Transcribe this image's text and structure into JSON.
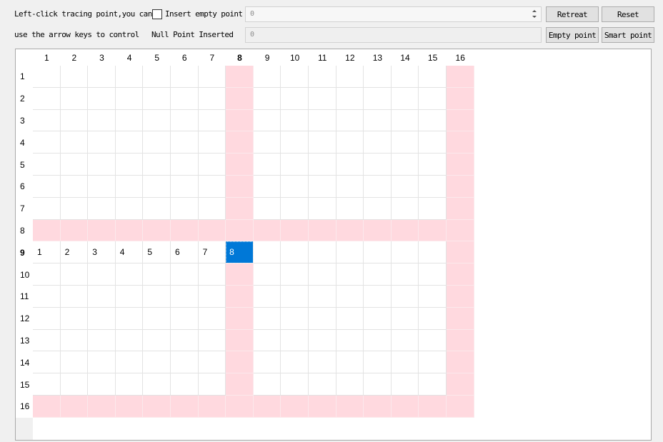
{
  "controls": {
    "hint_line1": "Left-click tracing point,you can",
    "insert_empty_checkbox": {
      "label": "Insert empty point",
      "checked": false
    },
    "spin_value": "0",
    "retreat_button": "Retreat",
    "reset_button": "Reset",
    "hint_line2": "use the arrow keys to control",
    "null_point_label": "Null Point Inserted",
    "null_point_value": "0",
    "empty_point_button": "Empty point",
    "smart_point_button": "Smart point"
  },
  "colors": {
    "highlight": "#ffd9df",
    "selection": "#0078d7"
  },
  "grid": {
    "column_headers": [
      "1",
      "2",
      "3",
      "4",
      "5",
      "6",
      "7",
      "8",
      "9",
      "10",
      "11",
      "12",
      "13",
      "14",
      "15",
      "16"
    ],
    "row_headers": [
      "1",
      "2",
      "3",
      "4",
      "5",
      "6",
      "7",
      "8",
      "9",
      "10",
      "11",
      "12",
      "13",
      "14",
      "15",
      "16"
    ],
    "highlighted_columns": [
      8,
      16
    ],
    "highlighted_rows": [
      8,
      16
    ],
    "current_cell": {
      "row": 9,
      "column": 8
    },
    "filled_cells": [
      {
        "row": 9,
        "column": 1,
        "value": "1"
      },
      {
        "row": 9,
        "column": 2,
        "value": "2"
      },
      {
        "row": 9,
        "column": 3,
        "value": "3"
      },
      {
        "row": 9,
        "column": 4,
        "value": "4"
      },
      {
        "row": 9,
        "column": 5,
        "value": "5"
      },
      {
        "row": 9,
        "column": 6,
        "value": "6"
      },
      {
        "row": 9,
        "column": 7,
        "value": "7"
      },
      {
        "row": 9,
        "column": 8,
        "value": "8"
      }
    ]
  }
}
